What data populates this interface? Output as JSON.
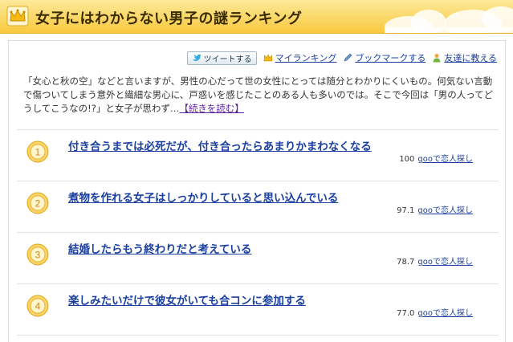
{
  "header": {
    "title": "女子にはわからない男子の謎ランキング",
    "bg_color": "#f8c93d"
  },
  "toolbar": {
    "tweet_label": "ツイートする",
    "my_ranking": "マイランキング",
    "bookmark": "ブックマークする",
    "tell_friend": "友達に教える"
  },
  "intro": {
    "text": "「女心と秋の空」などと言いますが、男性の心だって世の女性にとっては随分とわかりにくいもの。何気ない言動で傷ついてしまう意外と繊細な男心に、戸惑いを感じたことのある人も多いのでは。そこで今回は「男の人ってどうしてこうなの!?」と女子が思わず…",
    "more_link": "【続きを読む】"
  },
  "rankings": [
    {
      "rank": "1",
      "title": "付き合うまでは必死だが、付き合ったらあまりかまわなくなる",
      "score": "100",
      "goo_link": "gooで恋人探し"
    },
    {
      "rank": "2",
      "title": "煮物を作れる女子はしっかりしていると思い込んでいる",
      "score": "97.1",
      "goo_link": "gooで恋人探し"
    },
    {
      "rank": "3",
      "title": "結婚したらもう終わりだと考えている",
      "score": "78.7",
      "goo_link": "gooで恋人探し"
    },
    {
      "rank": "4",
      "title": "楽しみたいだけで彼女がいても合コンに参加する",
      "score": "77.0",
      "goo_link": "gooで恋人探し"
    }
  ],
  "colors": {
    "link": "#1a3fa0",
    "medal": "#f0b820"
  }
}
